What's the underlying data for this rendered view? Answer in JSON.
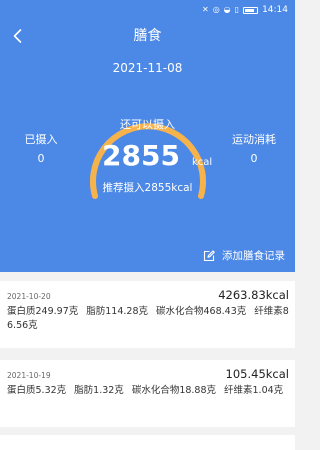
{
  "status_bar": {
    "time": "14:14",
    "icons": [
      "notification-mute-icon",
      "alarm-icon",
      "wifi-icon",
      "sim-icon",
      "battery-icon"
    ]
  },
  "header": {
    "title": "膳食",
    "back_icon": "chevron-left-icon"
  },
  "summary": {
    "date": "2021-11-08",
    "intake_label": "已摄入",
    "intake_value": "0",
    "remaining_label": "还可以摄入",
    "remaining_value": "2855",
    "remaining_unit": "kcal",
    "recommend_text": "推荐摄入2855kcal",
    "exercise_label": "运动消耗",
    "exercise_value": "0",
    "gauge_fraction": 1.0
  },
  "actions": {
    "add_record_label": "添加膳食记录",
    "add_record_icon": "edit-icon"
  },
  "records": [
    {
      "date": "2021-10-20",
      "total": "4263.83kcal",
      "protein": "蛋白质249.97克",
      "fat": "脂肪114.28克",
      "carbs": "碳水化合物468.43克",
      "fiber": "纤维素86.56克"
    },
    {
      "date": "2021-10-19",
      "total": "105.45kcal",
      "protein": "蛋白质5.32克",
      "fat": "脂肪1.32克",
      "carbs": "碳水化合物18.88克",
      "fiber": "纤维素1.04克"
    }
  ],
  "colors": {
    "header_bg": "#4c88e6",
    "gauge_arc": "#f6b24b",
    "page_bg": "#f2f2f2",
    "card_bg": "#ffffff"
  }
}
